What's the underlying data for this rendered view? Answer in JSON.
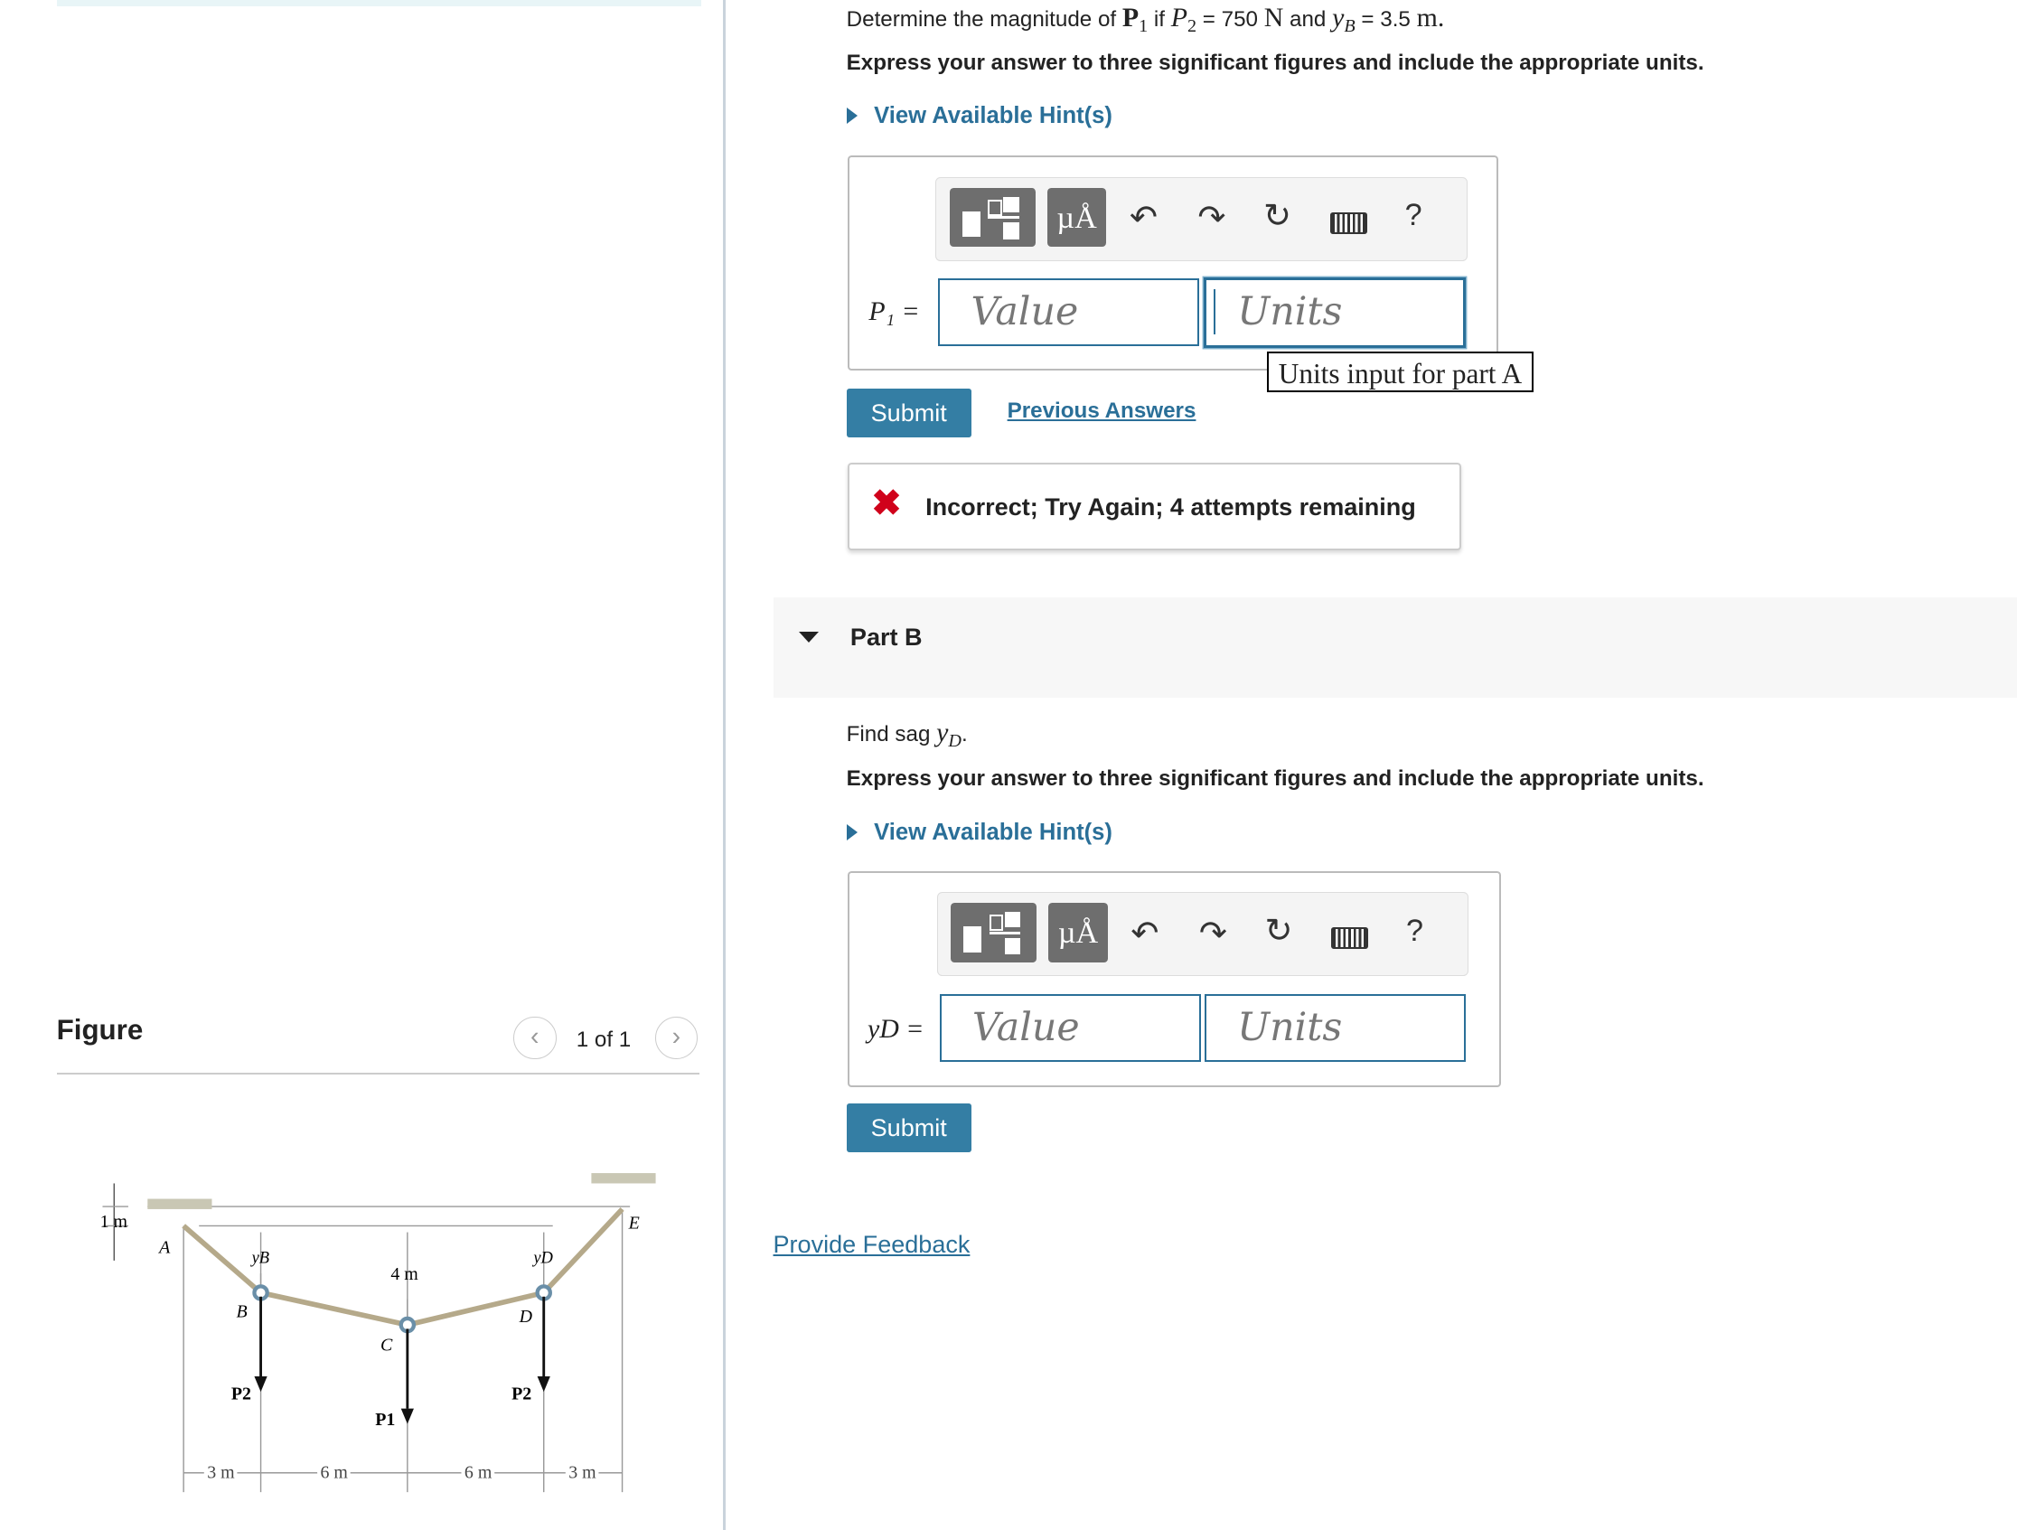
{
  "figure": {
    "title": "Figure",
    "pager": "1 of 1",
    "prev_icon": "chevron-left-icon",
    "next_icon": "chevron-right-icon",
    "labels": {
      "one_m": "1 m",
      "A": "A",
      "B": "B",
      "C": "C",
      "D": "D",
      "E": "E",
      "yB": "yB",
      "yD": "yD",
      "four_m": "4 m",
      "P2": "P2",
      "P1": "P1",
      "d1": "3 m",
      "d2": "6 m",
      "d3": "6 m",
      "d4": "3 m"
    }
  },
  "partA": {
    "prompt_pre": "Determine the magnitude of ",
    "prompt_P1": "P",
    "prompt_mid": " if ",
    "prompt_P2": "P",
    "prompt_val": " = 750 ",
    "prompt_N": "N",
    "prompt_and": " and ",
    "prompt_yB": "y",
    "prompt_yBsub": "B",
    "prompt_val2": " = 3.5 ",
    "prompt_m": "m.",
    "instruction": "Express your answer to three significant figures and include the appropriate units.",
    "hint": "View Available Hint(s)",
    "var_label": "P₁ =",
    "value_placeholder": "Value",
    "units_placeholder": "Units",
    "units_tooltip": "Units input for part A",
    "submit": "Submit",
    "previous_answers": "Previous Answers",
    "feedback": "Incorrect; Try Again; 4 attempts remaining"
  },
  "partB": {
    "title": "Part B",
    "prompt": "Find sag ",
    "prompt_var": "y",
    "prompt_sub": "D",
    "prompt_end": ".",
    "instruction": "Express your answer to three significant figures and include the appropriate units.",
    "hint": "View Available Hint(s)",
    "var_label": "yD =",
    "value_placeholder": "Value",
    "units_placeholder": "Units",
    "submit": "Submit"
  },
  "toolbar": {
    "units_btn": "µÅ",
    "help": "?"
  },
  "provide_feedback": "Provide Feedback",
  "colors": {
    "accent": "#347ea4",
    "link": "#2a6f98",
    "error": "#d0021b"
  }
}
